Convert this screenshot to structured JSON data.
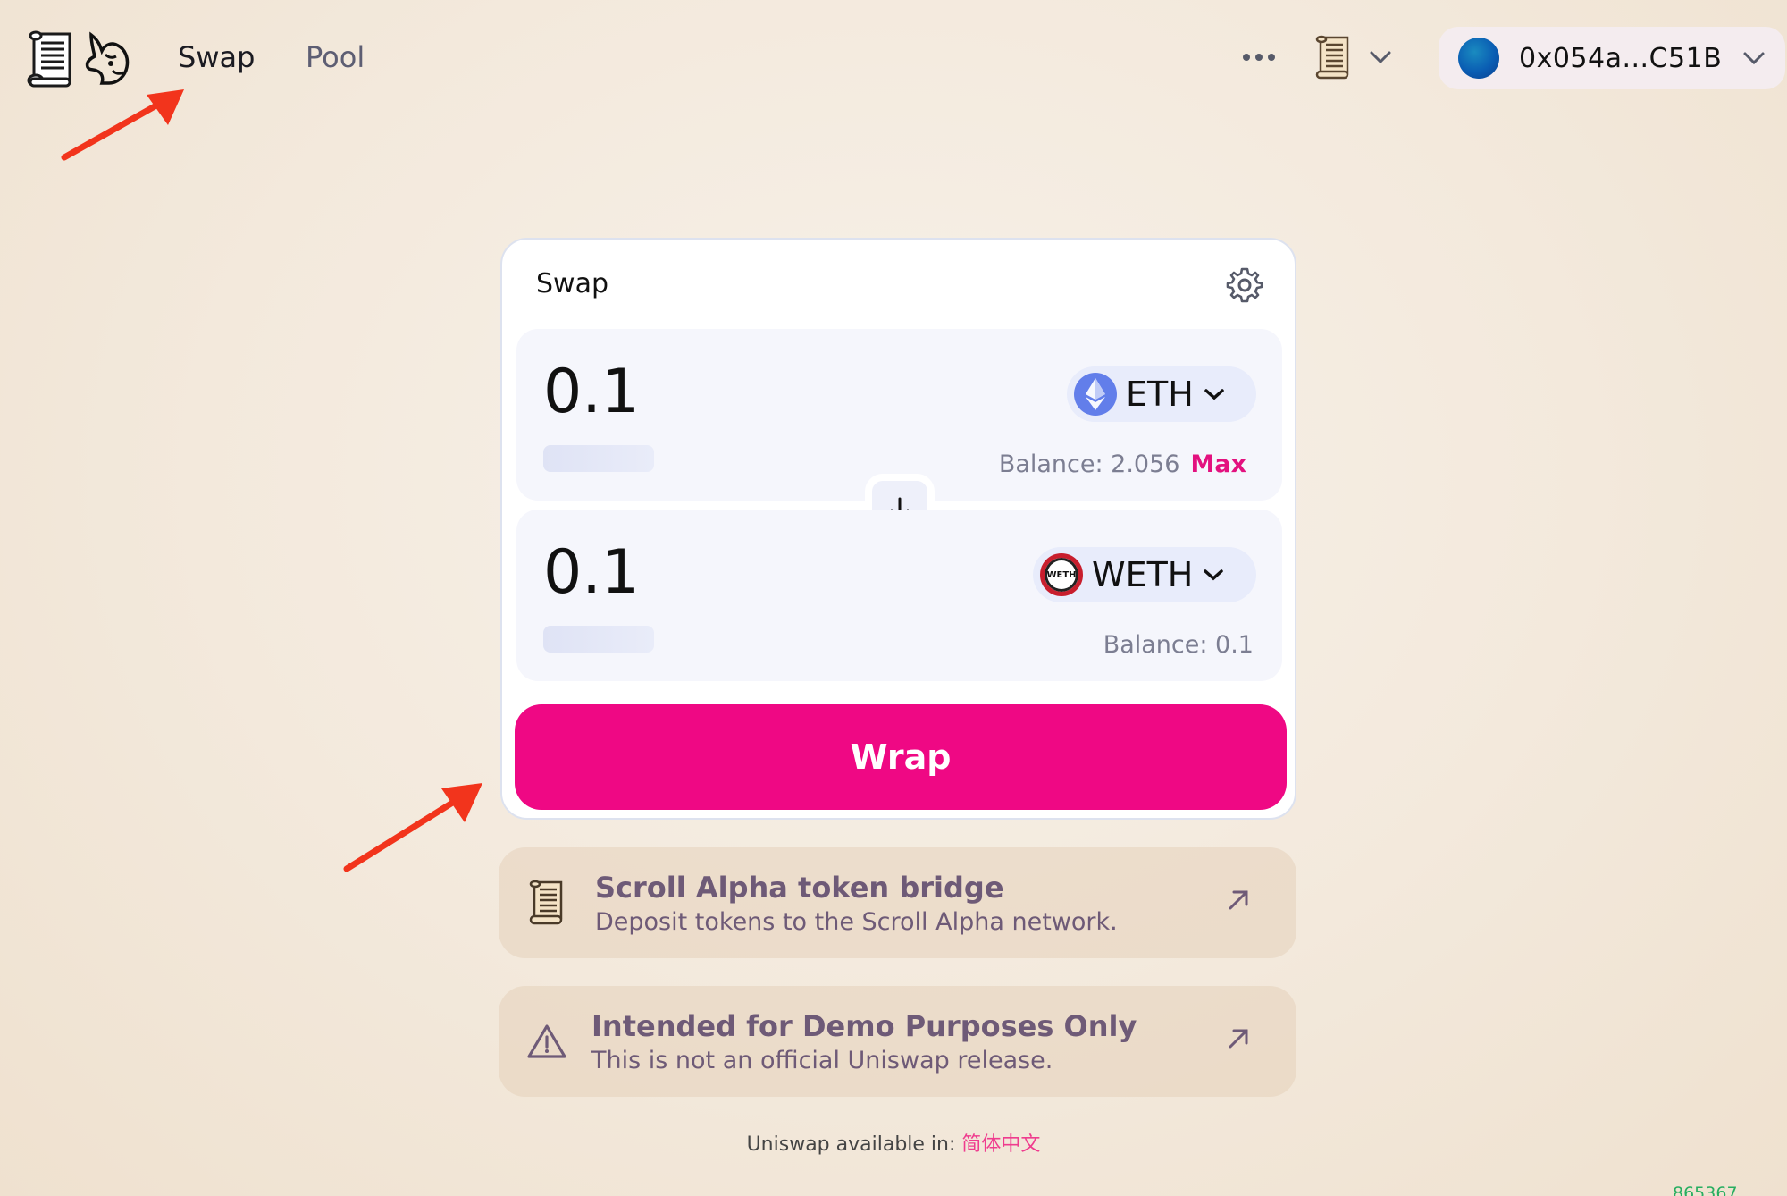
{
  "header": {
    "nav": [
      {
        "label": "Swap",
        "active": true
      },
      {
        "label": "Pool",
        "active": false
      }
    ],
    "more_icon": "ellipsis-icon",
    "network_icon": "scroll-logo-icon",
    "wallet": {
      "address": "0x054a...C51B"
    }
  },
  "swap": {
    "title": "Swap",
    "input": {
      "amount": "0.1",
      "token": "ETH",
      "balance_label": "Balance: 2.056",
      "max_label": "Max"
    },
    "output": {
      "amount": "0.1",
      "token": "WETH",
      "token_icon_text": "WETH",
      "balance_label": "Balance: 0.1"
    },
    "action_label": "Wrap"
  },
  "banners": [
    {
      "title": "Scroll Alpha token bridge",
      "subtitle": "Deposit tokens to the Scroll Alpha network."
    },
    {
      "title": "Intended for Demo Purposes Only",
      "subtitle": "This is not an official Uniswap release."
    }
  ],
  "footer": {
    "prefix": "Uniswap available in: ",
    "language": "简体中文",
    "block_number": "865367"
  },
  "colors": {
    "accent": "#ef0884",
    "annotation": "#f2341c",
    "text_muted": "#7c7e92"
  }
}
